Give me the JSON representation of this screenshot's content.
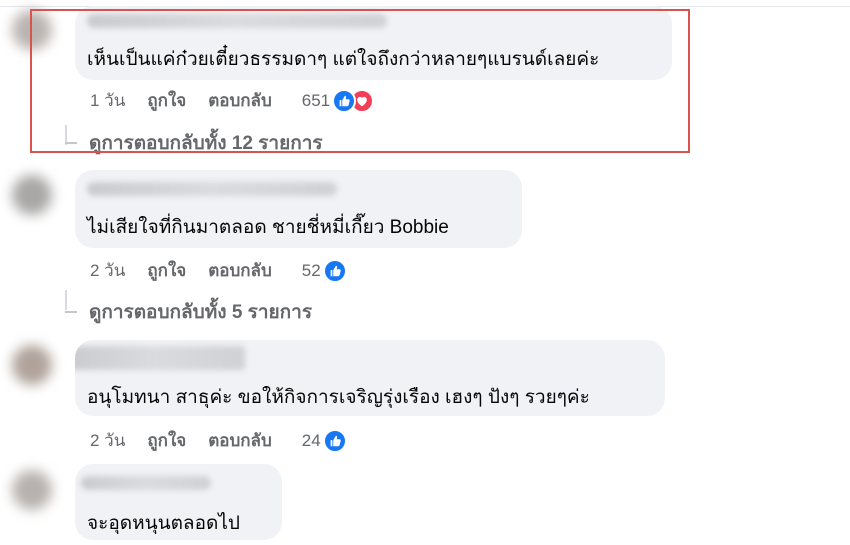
{
  "comments": [
    {
      "text": "เห็นเป็นแค่ก๋วยเตี๋ยวธรรมดาๆ แต่ใจถึงกว่าหลายๆแบรนด์เลยค่ะ",
      "time": "1 วัน",
      "like_label": "ถูกใจ",
      "reply_label": "ตอบกลับ",
      "reaction_count": "651",
      "reactions": [
        "like-icon",
        "love-icon"
      ],
      "view_replies": "ดูการตอบกลับทั้ง 12 รายการ"
    },
    {
      "text": "ไม่เสียใจที่กินมาตลอด ชายชี่หมี่เกี๊ยว Bobbie",
      "time": "2 วัน",
      "like_label": "ถูกใจ",
      "reply_label": "ตอบกลับ",
      "reaction_count": "52",
      "reactions": [
        "like-icon"
      ],
      "view_replies": "ดูการตอบกลับทั้ง 5 รายการ"
    },
    {
      "text": "อนุโมทนา สาธุค่ะ ขอให้กิจการเจริญรุ่งเรือง เฮงๆ ปังๆ รวยๆค่ะ",
      "time": "2 วัน",
      "like_label": "ถูกใจ",
      "reply_label": "ตอบกลับ",
      "reaction_count": "24",
      "reactions": [
        "like-icon"
      ]
    },
    {
      "text": "จะอุดหนุนตลอดไป"
    }
  ],
  "colors": {
    "bubble": "#f0f2f5",
    "meta_text": "#65676b",
    "like_blue": "#1877f2",
    "love_red": "#f33e58",
    "highlight_border": "#d9534f"
  }
}
